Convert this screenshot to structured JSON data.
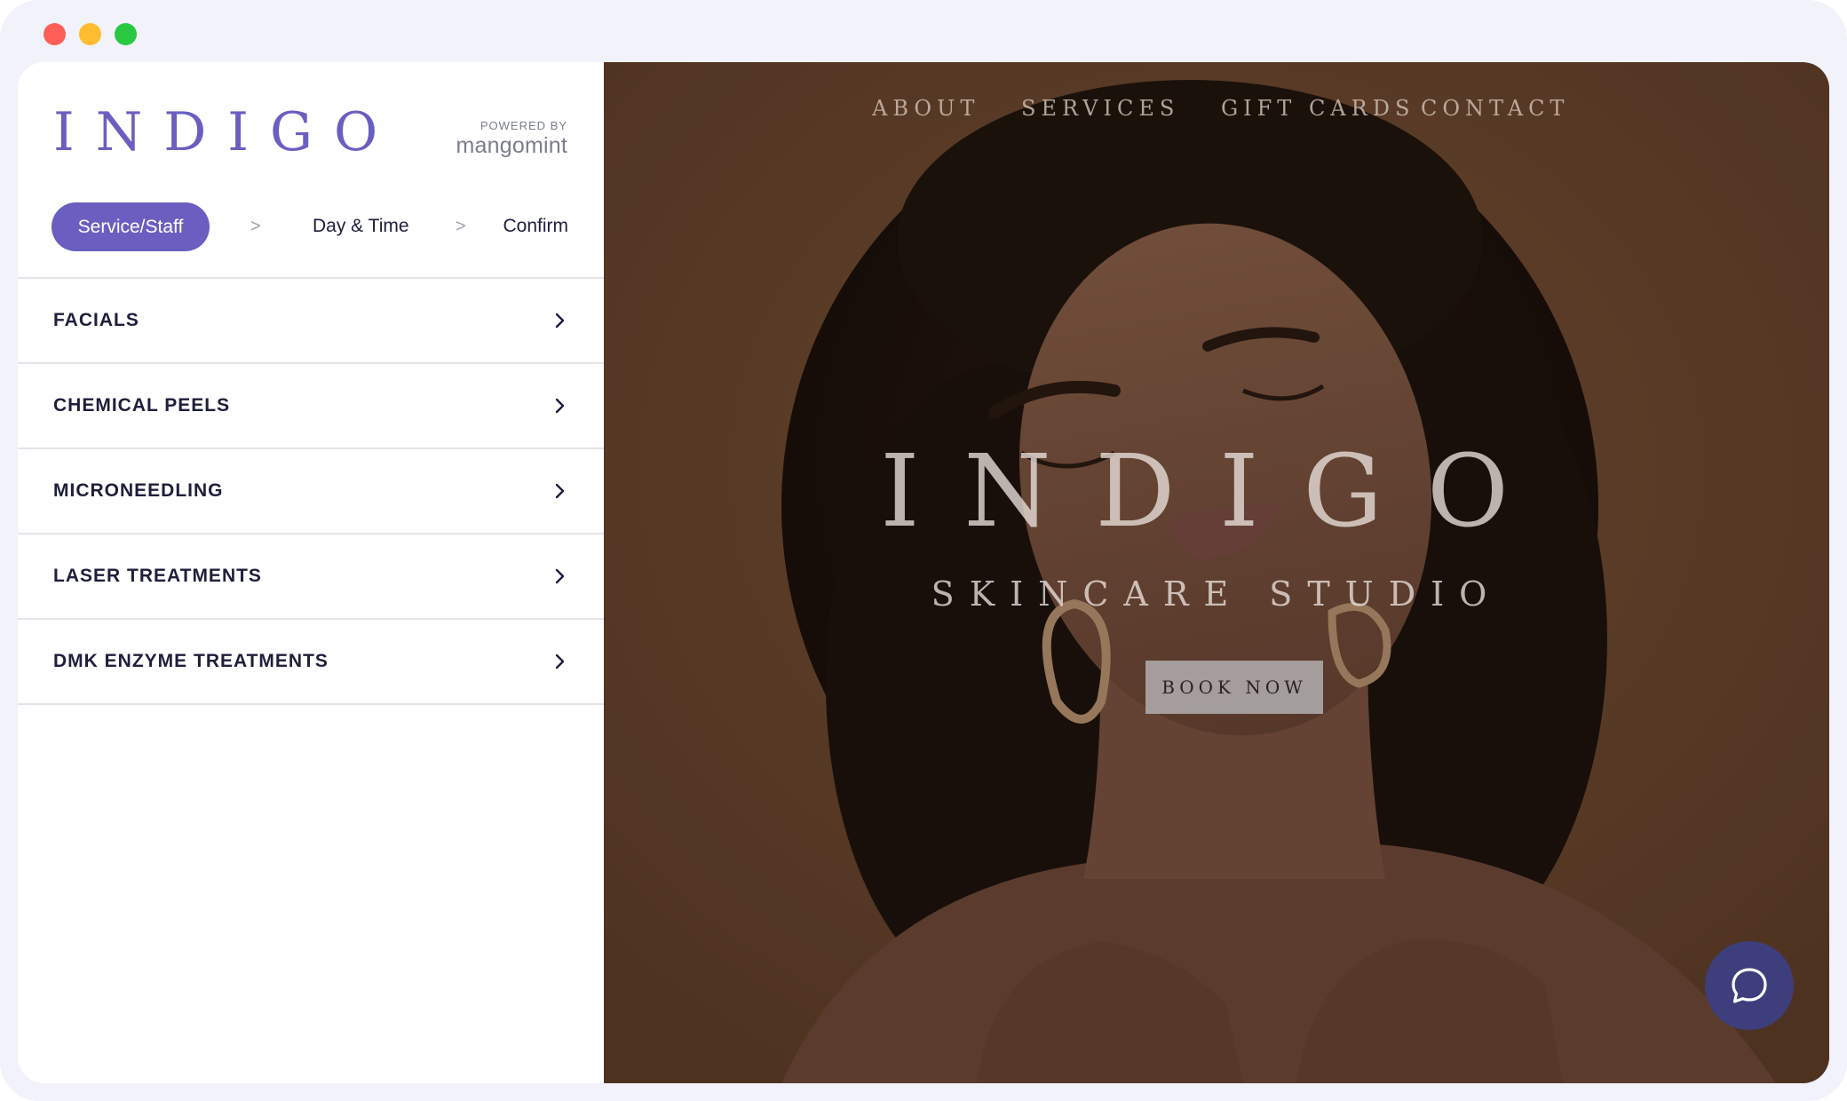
{
  "window": {
    "controls": [
      "close-icon",
      "minimize-icon",
      "maximize-icon"
    ],
    "control_colors": {
      "close": "#ff5f57",
      "minimize": "#febc2e",
      "maximize": "#28c840"
    }
  },
  "booking": {
    "logo": "INDIGO",
    "powered_by_label": "POWERED BY",
    "powered_by_brand": "mangomint",
    "accent": "#6a5fc0",
    "steps": {
      "active": "Service/Staff",
      "separator": ">",
      "day_time": "Day & Time",
      "confirm": "Confirm"
    },
    "categories": [
      {
        "label": "FACIALS",
        "icon": "chevron-right-icon"
      },
      {
        "label": "CHEMICAL PEELS",
        "icon": "chevron-right-icon"
      },
      {
        "label": "MICRONEEDLING",
        "icon": "chevron-right-icon"
      },
      {
        "label": "LASER TREATMENTS",
        "icon": "chevron-right-icon"
      },
      {
        "label": "DMK ENZYME TREATMENTS",
        "icon": "chevron-right-icon"
      }
    ]
  },
  "site": {
    "nav": [
      "ABOUT",
      "SERVICES",
      "GIFT CARDS",
      "CONTACT"
    ],
    "hero": {
      "title": "INDIGO",
      "subtitle": "SKINCARE STUDIO",
      "cta": "BOOK NOW"
    },
    "chat_icon": "chat-bubble-icon",
    "chat_color": "#3e3e7c"
  }
}
